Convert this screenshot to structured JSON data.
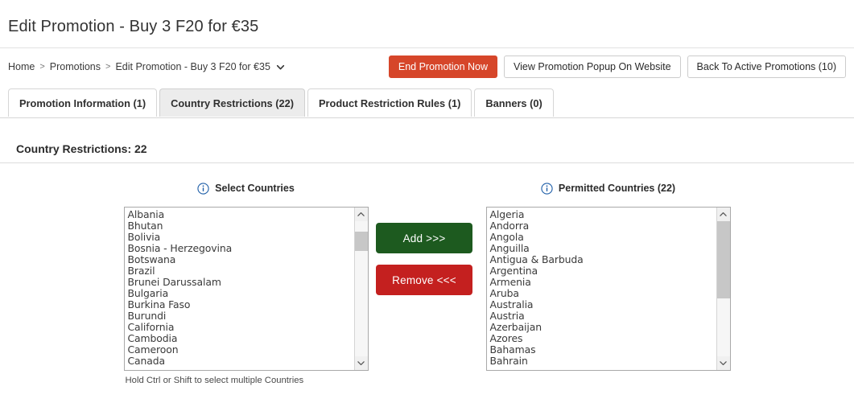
{
  "page": {
    "title": "Edit Promotion - Buy 3 F20 for €35"
  },
  "breadcrumb": {
    "items": [
      {
        "label": "Home"
      },
      {
        "label": "Promotions"
      },
      {
        "label": "Edit Promotion - Buy 3 F20 for €35"
      }
    ],
    "separator": ">",
    "caret_icon": "chevron-down-icon"
  },
  "actions": {
    "end_promotion": "End Promotion Now",
    "view_popup": "View Promotion Popup On Website",
    "back_to_active": "Back To Active Promotions (10)",
    "danger_color": "#d6462a"
  },
  "tabs": [
    {
      "label": "Promotion Information (1)",
      "active": false
    },
    {
      "label": "Country Restrictions (22)",
      "active": true
    },
    {
      "label": "Product Restriction Rules (1)",
      "active": false
    },
    {
      "label": "Banners (0)",
      "active": false
    }
  ],
  "section": {
    "heading": "Country Restrictions: 22"
  },
  "left_panel": {
    "label": "Select Countries",
    "info_icon": "info-circle-icon",
    "hint": "Hold Ctrl or Shift to select multiple Countries",
    "options": [
      "Albania",
      "Bhutan",
      "Bolivia",
      "Bosnia - Herzegovina",
      "Botswana",
      "Brazil",
      "Brunei Darussalam",
      "Bulgaria",
      "Burkina Faso",
      "Burundi",
      "California",
      "Cambodia",
      "Cameroon",
      "Canada"
    ],
    "scroll": {
      "thumb_top_pct": 8,
      "thumb_height_pct": 14
    }
  },
  "right_panel": {
    "label": "Permitted Countries (22)",
    "info_icon": "info-circle-icon",
    "options": [
      "Algeria",
      "Andorra",
      "Angola",
      "Anguilla",
      "Antigua & Barbuda",
      "Argentina",
      "Armenia",
      "Aruba",
      "Australia",
      "Austria",
      "Azerbaijan",
      "Azores",
      "Bahamas",
      "Bahrain"
    ],
    "scroll": {
      "thumb_top_pct": 0,
      "thumb_height_pct": 57
    }
  },
  "transfer": {
    "add_label": "Add >>>",
    "remove_label": "Remove <<<",
    "add_color": "#1d5a1f",
    "remove_color": "#c4201f"
  }
}
